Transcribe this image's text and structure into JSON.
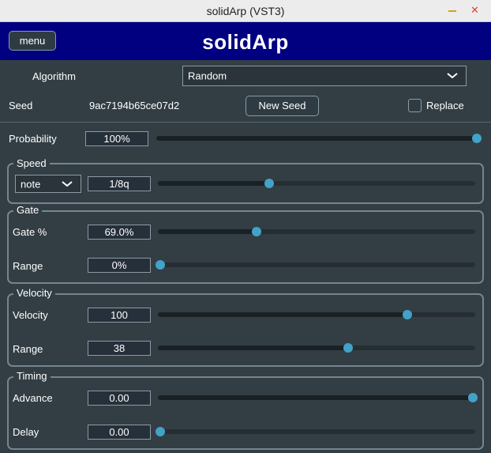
{
  "window": {
    "title": "solidArp (VST3)",
    "close_glyph": "✕"
  },
  "header": {
    "menu_label": "menu",
    "app_title": "solidArp"
  },
  "algorithm": {
    "label": "Algorithm",
    "value": "Random"
  },
  "seed": {
    "label": "Seed",
    "value": "9ac7194b65ce07d2",
    "new_seed_label": "New Seed",
    "replace_label": "Replace",
    "replace_checked": false
  },
  "probability": {
    "label": "Probability",
    "value_text": "100%",
    "level": 1.0
  },
  "speed": {
    "group_title": "Speed",
    "mode": "note",
    "value_text": "1/8q",
    "level": 0.35
  },
  "gate": {
    "group_title": "Gate",
    "gate": {
      "label": "Gate %",
      "value_text": "69.0%",
      "level": 0.31
    },
    "range": {
      "label": "Range",
      "value_text": "0%",
      "level": 0.0
    }
  },
  "velocity": {
    "group_title": "Velocity",
    "velocity": {
      "label": "Velocity",
      "value_text": "100",
      "level": 0.787
    },
    "range": {
      "label": "Range",
      "value_text": "38",
      "level": 0.6
    }
  },
  "timing": {
    "group_title": "Timing",
    "advance": {
      "label": "Advance",
      "value_text": "0.00",
      "level": 1.0
    },
    "delay": {
      "label": "Delay",
      "value_text": "0.00",
      "level": 0.0
    }
  },
  "colors": {
    "header_bg": "#000080",
    "panel_bg": "#323e44",
    "accent": "#42a2c8"
  }
}
